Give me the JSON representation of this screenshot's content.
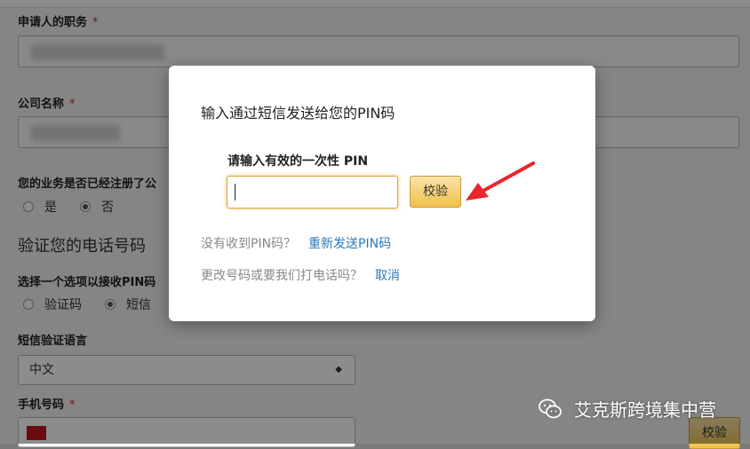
{
  "form": {
    "job_title_label": "申请人的职务",
    "required_mark": "*",
    "company_name_label": "公司名称",
    "business_registered_question": "您的业务是否已经注册了公",
    "radio_yes": "是",
    "radio_no": "否",
    "verify_phone_title": "验证您的电话号码",
    "receive_pin_option_label": "选择一个选项以接收PIN码",
    "option_code": "验证码",
    "option_sms": "短信",
    "sms_language_label": "短信验证语言",
    "sms_language_value": "中文",
    "phone_number_label": "手机号码",
    "verify_button": "校验"
  },
  "modal": {
    "title": "输入通过短信发送给您的PIN码",
    "pin_label": "请输入有效的一次性 PIN",
    "pin_value": "",
    "verify_button": "校验",
    "no_pin_text": "没有收到PIN码？",
    "resend_link": "重新发送PIN码",
    "change_number_text": "更改号码或要我们打电话吗？",
    "cancel_link": "取消"
  },
  "watermark": {
    "text": "艾克斯跨境集中营"
  },
  "colors": {
    "link": "#2a7ab8",
    "button_gold": "#f0c14b",
    "arrow_red": "#e8262b",
    "required": "#c9302c"
  }
}
